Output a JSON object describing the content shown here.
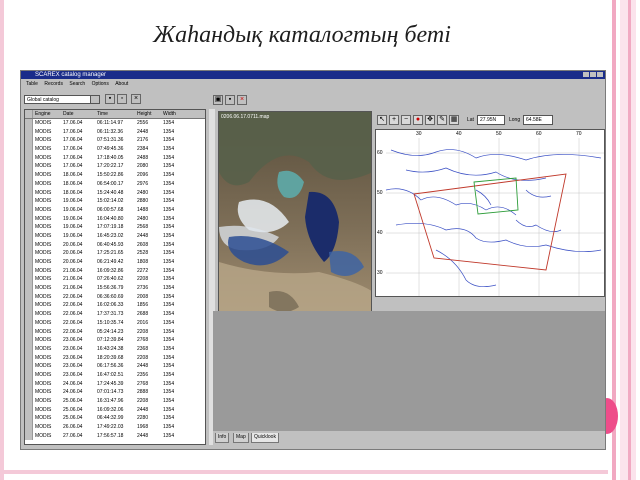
{
  "slide": {
    "title": "Жаһандық каталогтың беті"
  },
  "window": {
    "title": "SCAREX catalog manager",
    "menu": [
      "Table",
      "Records",
      "Search",
      "Options",
      "About"
    ]
  },
  "catalog": {
    "selected": "Global catalog"
  },
  "table": {
    "columns": [
      "Engine",
      "Date",
      "Time",
      "Height",
      "Width"
    ],
    "rows": [
      [
        "MODIS",
        "17.06.04",
        "06:11:14.97",
        "2556",
        "1354"
      ],
      [
        "MODIS",
        "17.06.04",
        "06:11:32.36",
        "2448",
        "1354"
      ],
      [
        "MODIS",
        "17.06.04",
        "07:51:31.36",
        "2176",
        "1354"
      ],
      [
        "MODIS",
        "17.06.04",
        "07:49:45.36",
        "2384",
        "1354"
      ],
      [
        "MODIS",
        "17.06.04",
        "17:18:40.05",
        "2488",
        "1354"
      ],
      [
        "MODIS",
        "17.06.04",
        "17:20:22.17",
        "2080",
        "1354"
      ],
      [
        "MODIS",
        "18.06.04",
        "15:50:22.86",
        "2096",
        "1354"
      ],
      [
        "MODIS",
        "18.06.04",
        "06:54:00.17",
        "2976",
        "1354"
      ],
      [
        "MODIS",
        "18.06.04",
        "15:24:40.48",
        "2480",
        "1354"
      ],
      [
        "MODIS",
        "19.06.04",
        "15:02:14.02",
        "2880",
        "1354"
      ],
      [
        "MODIS",
        "19.06.04",
        "06:00:57.68",
        "1488",
        "1354"
      ],
      [
        "MODIS",
        "19.06.04",
        "16:04:40.80",
        "2480",
        "1354"
      ],
      [
        "MODIS",
        "19.06.04",
        "17:07:19.18",
        "2568",
        "1354"
      ],
      [
        "MODIS",
        "19.06.04",
        "16:45:23.02",
        "2448",
        "1354"
      ],
      [
        "MODIS",
        "20.06.04",
        "06:40:45.93",
        "2608",
        "1354"
      ],
      [
        "MODIS",
        "20.06.04",
        "17:25:21.65",
        "2528",
        "1354"
      ],
      [
        "MODIS",
        "20.06.04",
        "06:21:49.42",
        "1808",
        "1354"
      ],
      [
        "MODIS",
        "21.06.04",
        "16:09:32.86",
        "2272",
        "1354"
      ],
      [
        "MODIS",
        "21.06.04",
        "07:26:40.62",
        "2208",
        "1354"
      ],
      [
        "MODIS",
        "21.06.04",
        "15:56:36.79",
        "2736",
        "1354"
      ],
      [
        "MODIS",
        "22.06.04",
        "06:36:60.69",
        "2008",
        "1354"
      ],
      [
        "MODIS",
        "22.06.04",
        "16:02:06.33",
        "1856",
        "1354"
      ],
      [
        "MODIS",
        "22.06.04",
        "17:37:31.73",
        "2688",
        "1354"
      ],
      [
        "MODIS",
        "22.06.04",
        "15:10:35.74",
        "2016",
        "1354"
      ],
      [
        "MODIS",
        "22.06.04",
        "05:24:14.23",
        "2208",
        "1354"
      ],
      [
        "MODIS",
        "23.06.04",
        "07:12:39.84",
        "2768",
        "1354"
      ],
      [
        "MODIS",
        "23.06.04",
        "16:43:24.38",
        "2368",
        "1354"
      ],
      [
        "MODIS",
        "23.06.04",
        "18:20:39.68",
        "2208",
        "1354"
      ],
      [
        "MODIS",
        "23.06.04",
        "06:17:56.36",
        "2448",
        "1354"
      ],
      [
        "MODIS",
        "23.06.04",
        "16:47:02.51",
        "2356",
        "1354"
      ],
      [
        "MODIS",
        "24.06.04",
        "17:24:45.39",
        "2768",
        "1354"
      ],
      [
        "MODIS",
        "24.06.04",
        "07:01:14.73",
        "2888",
        "1354"
      ],
      [
        "MODIS",
        "25.06.04",
        "16:31:47.96",
        "2208",
        "1354"
      ],
      [
        "MODIS",
        "25.06.04",
        "16:09:32.06",
        "2448",
        "1354"
      ],
      [
        "MODIS",
        "25.06.04",
        "06:44:32.99",
        "2280",
        "1354"
      ],
      [
        "MODIS",
        "26.06.04",
        "17:49:22.03",
        "1968",
        "1354"
      ],
      [
        "MODIS",
        "27.06.04",
        "17:56:57.18",
        "2448",
        "1354"
      ]
    ]
  },
  "map": {
    "lat_label": "Lat",
    "lat_value": "27.95N",
    "long_label": "Long",
    "long_value": "64.58E",
    "x_ticks": [
      "30",
      "40",
      "50",
      "60",
      "70"
    ],
    "y_ticks": [
      "60",
      "50",
      "40",
      "30"
    ]
  },
  "satellite": {
    "label": "0206.06.17.0711.map"
  },
  "tabs": [
    "Info",
    "Map",
    "Quicklook"
  ],
  "colors": {
    "accent_pink": "#ee4d8a",
    "titlebar": "#1a2c8a",
    "map_frame_red": "#c0392b",
    "map_frame_green": "#2e9d3a",
    "map_border_blue": "#3a4fc4"
  }
}
